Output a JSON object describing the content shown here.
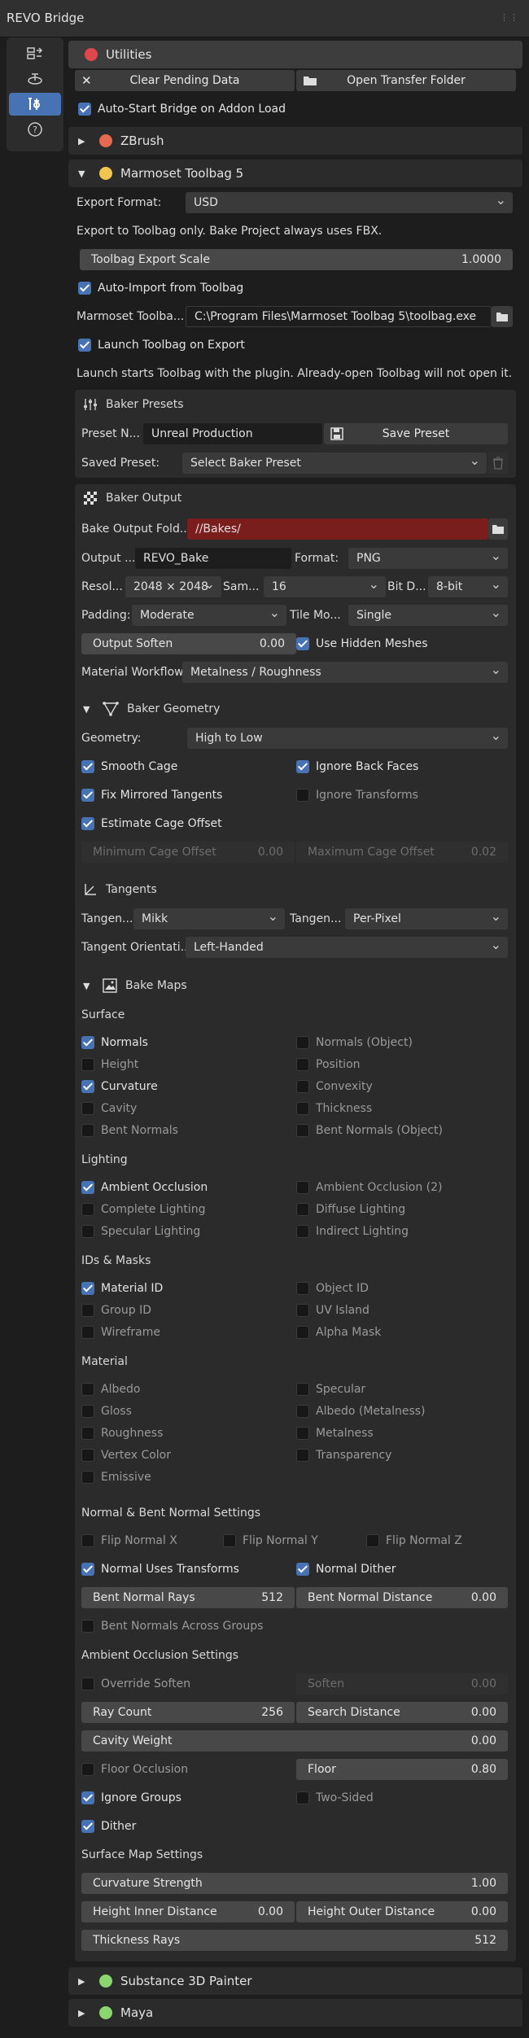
{
  "window": {
    "title": "REVO Bridge"
  },
  "utilities": {
    "title": "Utilities",
    "clear_btn": "Clear Pending Data",
    "open_btn": "Open Transfer Folder",
    "autostart": "Auto-Start Bridge on Addon Load"
  },
  "zbrush": {
    "title": "ZBrush"
  },
  "marmoset": {
    "title": "Marmoset Toolbag 5",
    "export_format_label": "Export Format:",
    "export_format_value": "USD",
    "export_info": "Export to Toolbag only. Bake Project always uses FBX.",
    "scale_label": "Toolbag Export Scale",
    "scale_value": "1.0000",
    "auto_import": "Auto-Import from Toolbag",
    "path_label": "Marmoset Toolba...",
    "path_value": "C:\\Program Files\\Marmoset Toolbag 5\\toolbag.exe",
    "launch": "Launch Toolbag on Export",
    "launch_info": "Launch starts Toolbag with the plugin. Already-open Toolbag will not open it."
  },
  "presets": {
    "title": "Baker Presets",
    "name_label": "Preset N...",
    "name_value": "Unreal Production",
    "save_btn": "Save Preset",
    "saved_label": "Saved Preset:",
    "saved_value": "Select Baker Preset"
  },
  "output": {
    "title": "Baker Output",
    "folder_label": "Bake Output Fold...",
    "folder_value": "//Bakes/",
    "name_label": "Output ...",
    "name_value": "REVO_Bake",
    "format_label": "Format:",
    "format_value": "PNG",
    "res_label": "Resol...",
    "res_value": "2048 × 2048",
    "sam_label": "Sam...",
    "sam_value": "16",
    "bitd_label": "Bit D...",
    "bitd_value": "8-bit",
    "padding_label": "Padding:",
    "padding_value": "Moderate",
    "tile_label": "Tile Mo...",
    "tile_value": "Single",
    "soften_label": "Output Soften",
    "soften_value": "0.00",
    "hidden_meshes": "Use Hidden Meshes",
    "workflow_label": "Material Workflow:",
    "workflow_value": "Metalness / Roughness"
  },
  "geometry": {
    "title": "Baker Geometry",
    "geo_label": "Geometry:",
    "geo_value": "High to Low",
    "smooth_cage": "Smooth Cage",
    "ignore_back": "Ignore Back Faces",
    "fix_mirrored": "Fix Mirrored Tangents",
    "ignore_transforms": "Ignore Transforms",
    "estimate_cage": "Estimate Cage Offset",
    "min_cage_label": "Minimum Cage Offset",
    "min_cage_value": "0.00",
    "max_cage_label": "Maximum Cage Offset",
    "max_cage_value": "0.02"
  },
  "tangents": {
    "title": "Tangents",
    "t1_label": "Tangen...",
    "t1_value": "Mikk",
    "t2_label": "Tangen...",
    "t2_value": "Per-Pixel",
    "orient_label": "Tangent Orientati...",
    "orient_value": "Left-Handed"
  },
  "maps": {
    "title": "Bake Maps",
    "surface": "Surface",
    "lighting": "Lighting",
    "ids": "IDs & Masks",
    "material": "Material",
    "normals": "Normals",
    "normals_obj": "Normals (Object)",
    "height": "Height",
    "position": "Position",
    "curvature": "Curvature",
    "convexity": "Convexity",
    "cavity": "Cavity",
    "thickness": "Thickness",
    "bent_normals": "Bent Normals",
    "bent_normals_obj": "Bent Normals (Object)",
    "ao": "Ambient Occlusion",
    "ao2": "Ambient Occlusion (2)",
    "complete_lighting": "Complete Lighting",
    "diffuse_lighting": "Diffuse Lighting",
    "specular_lighting": "Specular Lighting",
    "indirect_lighting": "Indirect Lighting",
    "material_id": "Material ID",
    "object_id": "Object ID",
    "group_id": "Group ID",
    "uv_island": "UV Island",
    "wireframe": "Wireframe",
    "alpha_mask": "Alpha Mask",
    "albedo": "Albedo",
    "specular": "Specular",
    "gloss": "Gloss",
    "albedo_metal": "Albedo (Metalness)",
    "roughness": "Roughness",
    "metalness": "Metalness",
    "vertex_color": "Vertex Color",
    "transparency": "Transparency",
    "emissive": "Emissive"
  },
  "normal_settings": {
    "title": "Normal & Bent Normal Settings",
    "flip_x": "Flip Normal X",
    "flip_y": "Flip Normal Y",
    "flip_z": "Flip Normal Z",
    "uses_transforms": "Normal Uses Transforms",
    "dither": "Normal Dither",
    "rays_label": "Bent Normal Rays",
    "rays_value": "512",
    "dist_label": "Bent Normal Distance",
    "dist_value": "0.00",
    "across_groups": "Bent Normals Across Groups"
  },
  "ao_settings": {
    "title": "Ambient Occlusion Settings",
    "override_soften": "Override Soften",
    "soften_label": "Soften",
    "soften_value": "0.00",
    "ray_label": "Ray Count",
    "ray_value": "256",
    "search_label": "Search Distance",
    "search_value": "0.00",
    "cavity_label": "Cavity Weight",
    "cavity_value": "0.00",
    "floor_occlusion": "Floor Occlusion",
    "floor_label": "Floor",
    "floor_value": "0.80",
    "ignore_groups": "Ignore Groups",
    "two_sided": "Two-Sided",
    "dither": "Dither"
  },
  "surface_settings": {
    "title": "Surface Map Settings",
    "curv_label": "Curvature Strength",
    "curv_value": "1.00",
    "hin_label": "Height Inner Distance",
    "hin_value": "0.00",
    "hout_label": "Height Outer Distance",
    "hout_value": "0.00",
    "thick_label": "Thickness Rays",
    "thick_value": "512"
  },
  "substance": {
    "title": "Substance 3D Painter"
  },
  "maya": {
    "title": "Maya"
  },
  "colors": {
    "accent": "#4772b3",
    "utilities_dot": "#e0474c",
    "zbrush_dot": "#e56a4f",
    "marmoset_dot": "#f1c64f",
    "substance_dot": "#8bd66e",
    "maya_dot": "#8bd66e",
    "folder_field": "#7a1d1d"
  },
  "icons": [
    "sidebar-tool-icon",
    "sidebar-view-icon",
    "sidebar-settings-icon",
    "sidebar-help-icon",
    "close-icon",
    "folder-icon",
    "save-icon",
    "trash-icon",
    "sliders-icon",
    "checker-icon",
    "cage-icon",
    "tangent-axis-icon",
    "image-icon"
  ]
}
